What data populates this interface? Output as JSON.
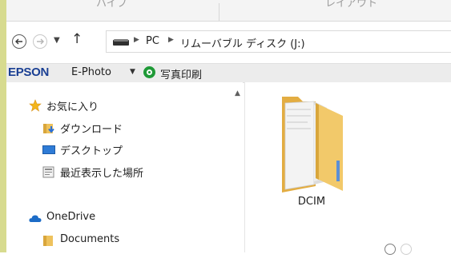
{
  "window": {
    "ribbon_tabs": [
      "ハイプ",
      "レイアウト"
    ]
  },
  "navigation": {
    "breadcrumb": [
      "PC",
      "リムーバブル ディスク (J:)"
    ],
    "icons": [
      "back-arrow-icon",
      "forward-arrow-icon",
      "recent-dropdown-icon",
      "up-arrow-icon",
      "drive-icon"
    ]
  },
  "epson_toolbar": {
    "brand": "EPSON",
    "app": "E-Photo",
    "print_label": "写真印刷"
  },
  "sidebar": {
    "items": [
      {
        "label": "お気に入り",
        "icon": "star-icon"
      },
      {
        "label": "ダウンロード",
        "icon": "downloads-icon"
      },
      {
        "label": "デスクトップ",
        "icon": "desktop-icon"
      },
      {
        "label": "最近表示した場所",
        "icon": "recent-places-icon"
      },
      {
        "label": "OneDrive",
        "icon": "cloud-icon"
      },
      {
        "label": "Documents",
        "icon": "folder-icon"
      }
    ]
  },
  "content": {
    "items": [
      {
        "label": "DCIM",
        "icon": "folder-icon"
      }
    ]
  },
  "colors": {
    "accent_bar": "#d7db8f",
    "epson_blue": "#1a3f93",
    "print_green": "#1f9a37",
    "folder_yellow": "#f2c96a"
  }
}
